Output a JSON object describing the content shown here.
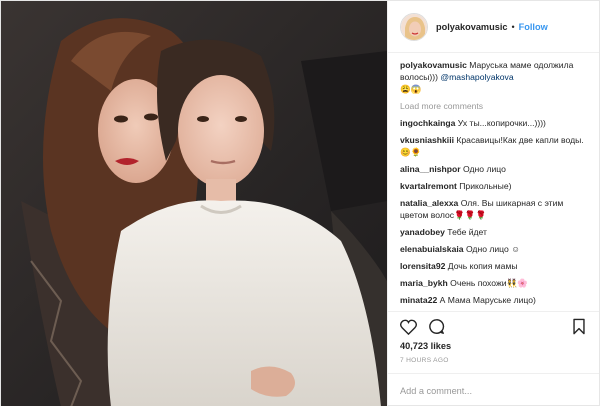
{
  "header": {
    "username": "polyakovamusic",
    "separator": "•",
    "follow_label": "Follow"
  },
  "caption": {
    "username": "polyakovamusic",
    "text": "Маруська маме одолжила волосы))) ",
    "mention": "@mashapolyakova",
    "emoji": "😩😱"
  },
  "load_more_label": "Load more comments",
  "comments": [
    {
      "user": "ingochkainga",
      "text": "Ух ты...копирочки...))))"
    },
    {
      "user": "vkusniashkiii",
      "text": "Красавицы!Как две капли воды.😊🌻"
    },
    {
      "user": "alina__nishpor",
      "text": "Одно лицо"
    },
    {
      "user": "kvartalremont",
      "text": "Прикольные)"
    },
    {
      "user": "natalia_alexxa",
      "text": "Оля. Вы шикарная с этим цветом волос🌹🌹🌹"
    },
    {
      "user": "yanadobey",
      "text": "Тебе йдет"
    },
    {
      "user": "elenabuialskaia",
      "text": "Одно лицо ☺"
    },
    {
      "user": "lorensita92",
      "text": "Дочь копия мамы"
    },
    {
      "user": "maria_bykh",
      "text": "Очень похожи👯🌸"
    },
    {
      "user": "minata22",
      "text": "А Мама Маруське лицо)"
    }
  ],
  "likes": "40,723 likes",
  "time": "7 HOURS AGO",
  "add_comment_placeholder": "Add a comment...",
  "icons": {
    "like": "heart-icon",
    "comment": "comment-icon",
    "save": "bookmark-icon"
  },
  "colors": {
    "link": "#3897f0",
    "mention": "#003569",
    "muted": "#999999"
  }
}
